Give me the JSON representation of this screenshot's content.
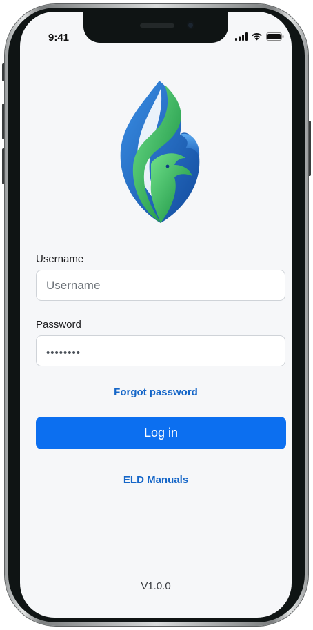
{
  "status_bar": {
    "time": "9:41"
  },
  "login_form": {
    "username_label": "Username",
    "username_placeholder": "Username",
    "username_value": "",
    "password_label": "Password",
    "password_value": "••••••••"
  },
  "links": {
    "forgot_password": "Forgot password",
    "eld_manuals": "ELD Manuals"
  },
  "actions": {
    "login_label": "Log in"
  },
  "footer": {
    "version": "V1.0.0"
  },
  "icons": {
    "logo": "flame-eagle-logo",
    "signal": "cellular-signal-icon",
    "wifi": "wifi-icon",
    "battery": "battery-icon"
  },
  "colors": {
    "primary": "#0c6ff0",
    "link": "#1566c8",
    "background": "#f6f7f9",
    "logo_blue": "#1f6fd0",
    "logo_green": "#2db84b"
  }
}
